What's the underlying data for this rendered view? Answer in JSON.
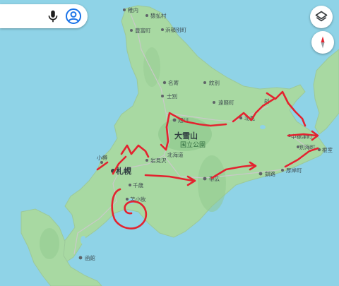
{
  "map_labels": {
    "wakkanai": "稚内",
    "sarufutsu": "猿払村",
    "toyotomi": "豊富町",
    "hamatonbetsu": "浜頓別町",
    "nayoro": "名寄",
    "shibetsu": "士別",
    "monbetsu": "紋別",
    "engaru": "遠軽町",
    "asahikawa": "旭川",
    "kitami": "北見",
    "shari": "斜",
    "daisetsuzan": "大雪山",
    "national_park": "国立公園",
    "hokkaido": "北海道",
    "iwamizawa": "岩見沢",
    "otaru": "小樽",
    "sapporo": "札幌",
    "chitose": "千歳",
    "tomakomai": "苫小牧",
    "obihiro": "帯広",
    "kushiro": "釧路",
    "akkeshi": "厚岸町",
    "nakashibetsu": "中標津町",
    "betsukai": "別海町",
    "nemuro": "根室",
    "hakodate": "函館"
  },
  "icons": {
    "mic": "mic-icon",
    "account": "account-circle-icon",
    "layers": "layers-icon",
    "compass": "compass-icon"
  },
  "colors": {
    "water": "#8fd3e7",
    "land": "#a8d9a2",
    "annotation": "#e3232f"
  }
}
